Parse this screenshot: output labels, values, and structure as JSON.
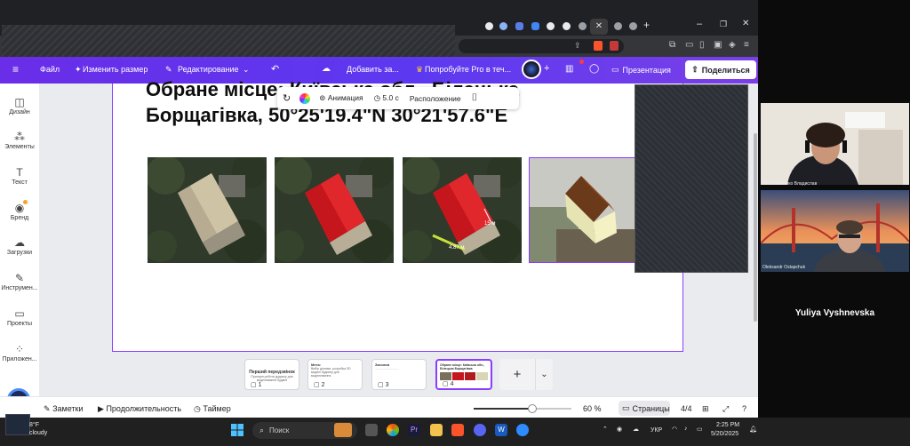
{
  "canva": {
    "menu": {
      "file": "Файл",
      "resize": "Изменить размер",
      "editing": "Редактирование",
      "add": "Добавить за...",
      "try_pro": "Попробуйте Pro в теч..."
    },
    "presentation": "Презентация",
    "share": "Поделиться",
    "sidebar": [
      {
        "label": "Дизайн",
        "icon": "layout-icon"
      },
      {
        "label": "Элементы",
        "icon": "shapes-icon"
      },
      {
        "label": "Текст",
        "icon": "text-icon"
      },
      {
        "label": "Бренд",
        "icon": "brand-icon"
      },
      {
        "label": "Загрузки",
        "icon": "upload-icon"
      },
      {
        "label": "Инструмен...",
        "icon": "tools-icon"
      },
      {
        "label": "Проекты",
        "icon": "folder-icon"
      },
      {
        "label": "Приложен...",
        "icon": "apps-icon"
      }
    ],
    "slide": {
      "title_line1": "Обране місце: Київська обл., Білецька",
      "title_line2": "Борщагівка, 50°25'19.4\"N 30°21'57.6\"E"
    },
    "context_toolbar": {
      "animation": "Анимация",
      "duration": "5.0 с",
      "position": "Расположение"
    },
    "images": {
      "measure_label_1": "15 м",
      "measure_label_2": "4.87 м"
    },
    "thumbnails": [
      {
        "num": "1",
        "title": "Перший передзвінок",
        "text": "Принцип роботи додатку для моделювання будівлі"
      },
      {
        "num": "2",
        "title": "Мета:",
        "text": "Вибір ділянки, розробка 3D моделі будинку для моделювання"
      },
      {
        "num": "3",
        "title": "Заголов",
        "text": "............................"
      },
      {
        "num": "4",
        "title": "Обране місце: Київська обл., Білецька Борщагівка",
        "text": ""
      }
    ],
    "footer": {
      "notes": "Заметки",
      "duration": "Продолжительность",
      "timer": "Таймер",
      "zoom": "60 %",
      "pages": "Страницы",
      "page_count": "4/4",
      "zoom_level": 0.6
    }
  },
  "participants": [
    {
      "name": "12-12 Хоменко Владислав"
    },
    {
      "name": "Oleksandr Ostapchuk"
    },
    {
      "name": "Yuliya Vyshnevska"
    }
  ],
  "taskbar": {
    "weather_temp": "8°F",
    "weather_desc": "cloudy",
    "search": "Поиск",
    "lang": "УКР",
    "time": "2:25 PM",
    "date": "5/20/2025"
  }
}
